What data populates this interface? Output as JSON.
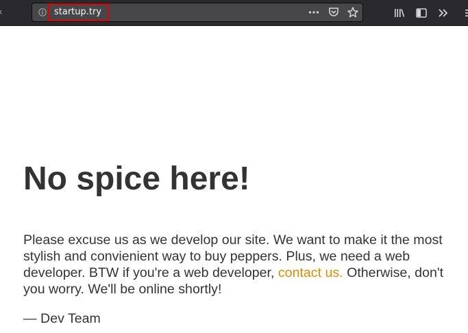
{
  "browser": {
    "url": "startup.try",
    "icons": [
      "info-icon",
      "page-actions-icon",
      "pocket-icon",
      "bookmark-star-icon",
      "library-icon",
      "sidebar-icon",
      "overflow-menu-icon"
    ],
    "highlight_color": "#e00000"
  },
  "page": {
    "heading": "No spice here!",
    "body_before_link": "Please excuse us as we develop our site. We want to make it the most stylish and convienient way to buy peppers. Plus, we need a web developer. BTW if you're a web developer, ",
    "link_text": "contact us.",
    "body_after_link": " Otherwise, don't you worry. We'll be online shortly!",
    "signature": "— Dev Team",
    "link_color": "#e08a00",
    "text_color": "#333333"
  }
}
